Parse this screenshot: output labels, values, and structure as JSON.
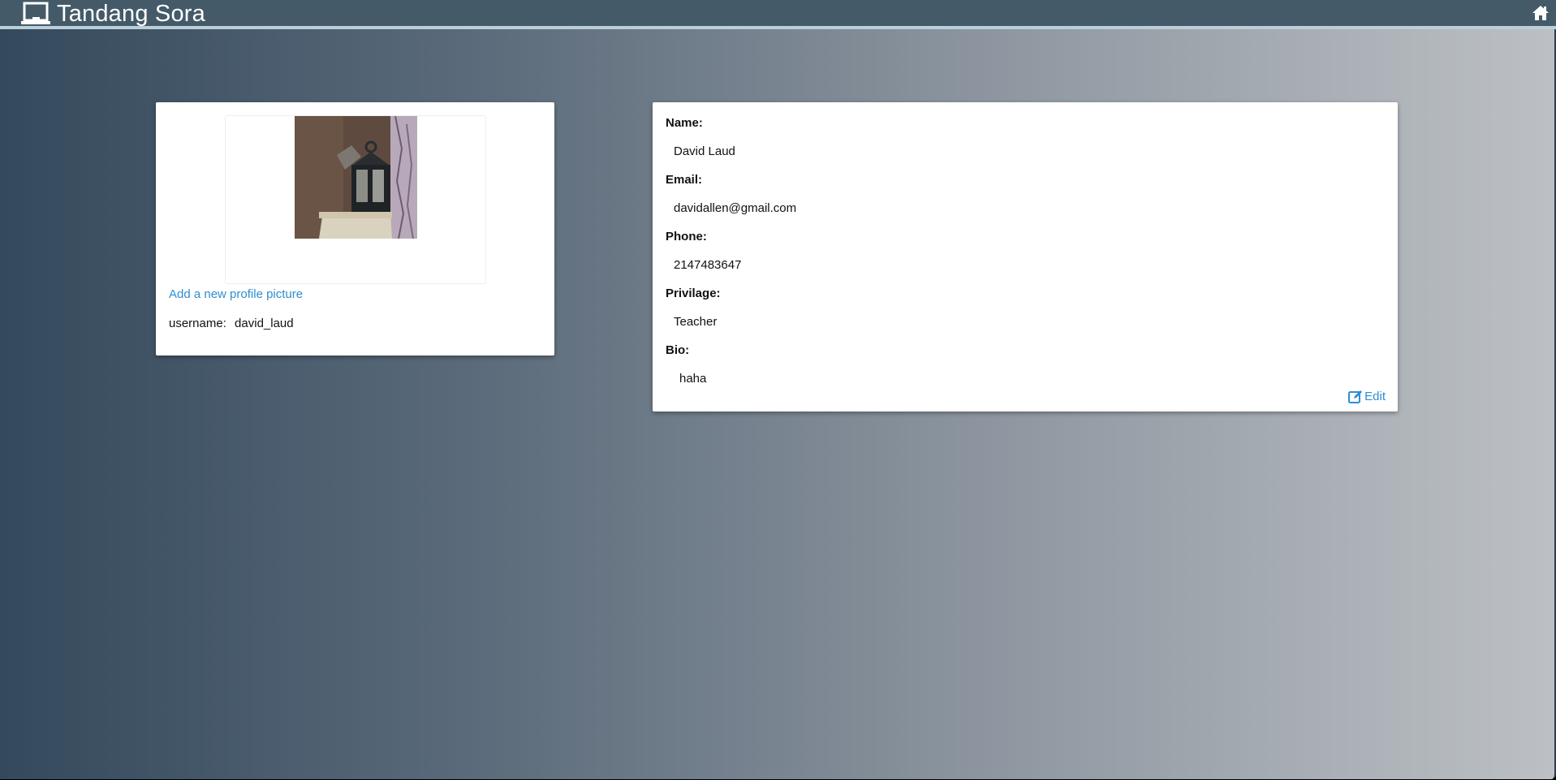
{
  "app": {
    "title": "Tandang Sora",
    "brand_icon": "laptop-icon",
    "home_icon": "home-icon"
  },
  "colors": {
    "topbar": "#445a68",
    "topbar_border": "#b9cfda",
    "link": "#2c8fd0",
    "card": "#ffffff"
  },
  "profile_card": {
    "add_picture_label": "Add a new profile picture",
    "username_label": "username:",
    "username_value": "david_laud"
  },
  "details": {
    "fields": [
      {
        "label": "Name:",
        "value": "David Laud"
      },
      {
        "label": "Email:",
        "value": "davidallen@gmail.com"
      },
      {
        "label": "Phone:",
        "value": "2147483647"
      },
      {
        "label": "Privilage:",
        "value": "Teacher"
      },
      {
        "label": "Bio:",
        "value": "haha"
      }
    ],
    "edit_label": "Edit",
    "edit_icon": "edit-icon"
  }
}
